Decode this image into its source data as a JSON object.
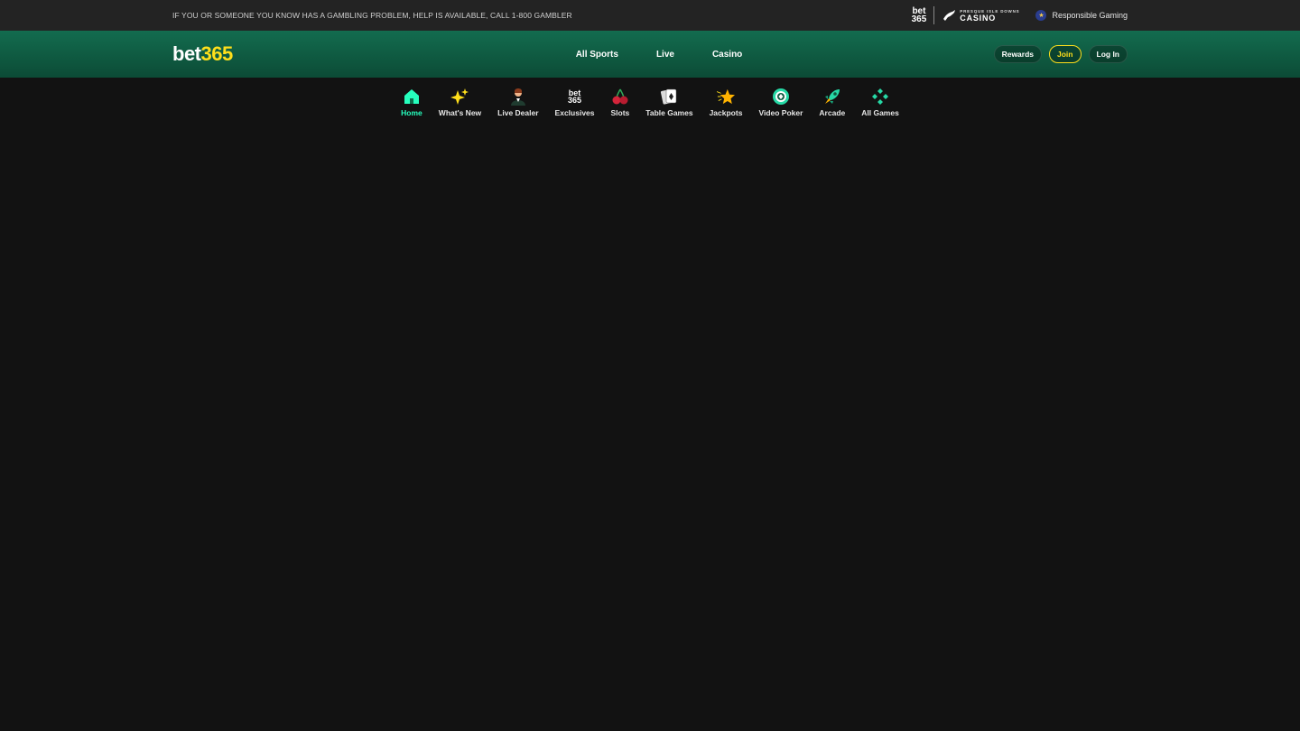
{
  "topbar": {
    "warning": "IF YOU OR SOMEONE YOU KNOW HAS A GAMBLING PROBLEM, HELP IS AVAILABLE, CALL 1-800 GAMBLER",
    "mini_logo_top": "bet",
    "mini_logo_bottom": "365",
    "pid_small": "PRESQUE ISLE DOWNS",
    "pid_big": "CASINO",
    "responsible_gaming": "Responsible Gaming"
  },
  "header": {
    "brand_part1": "bet",
    "brand_part2": "365",
    "nav": [
      "All Sports",
      "Live",
      "Casino"
    ],
    "rewards": "Rewards",
    "join": "Join",
    "login": "Log In"
  },
  "casino_nav": [
    {
      "label": "Home",
      "icon": "home-icon",
      "active": true
    },
    {
      "label": "What's New",
      "icon": "sparkles-icon"
    },
    {
      "label": "Live Dealer",
      "icon": "dealer-icon"
    },
    {
      "label": "Exclusives",
      "icon": "bet365-exclusives-icon"
    },
    {
      "label": "Slots",
      "icon": "cherries-icon"
    },
    {
      "label": "Table Games",
      "icon": "cards-icon"
    },
    {
      "label": "Jackpots",
      "icon": "star-icon"
    },
    {
      "label": "Video Poker",
      "icon": "poker-chip-icon"
    },
    {
      "label": "Arcade",
      "icon": "rocket-icon"
    },
    {
      "label": "All Games",
      "icon": "diamond-grid-icon"
    }
  ],
  "colors": {
    "accent_green": "#26ffbe",
    "brand_yellow": "#ffdf1b",
    "header_green": "#136c4f",
    "background": "#121212"
  }
}
